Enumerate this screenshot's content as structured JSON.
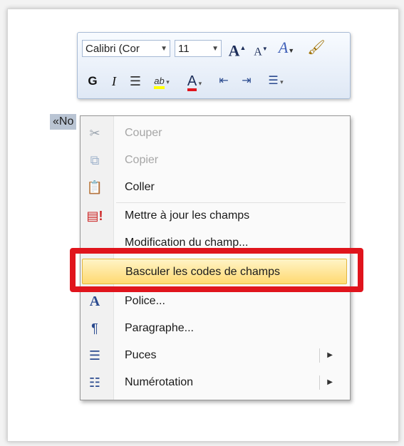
{
  "minibar": {
    "font_name": "Calibri (Cor",
    "font_size": "11",
    "grow_font": "A",
    "shrink_font": "A",
    "styles": "A",
    "bold": "G",
    "italic": "I",
    "font_color": "A"
  },
  "document": {
    "field_text": "«No",
    "field_end": "»"
  },
  "menu": {
    "items": [
      {
        "label": "Couper",
        "icon": "scissors-icon",
        "enabled": false
      },
      {
        "label": "Copier",
        "icon": "copy-icon",
        "enabled": false
      },
      {
        "label": "Coller",
        "icon": "paste-icon",
        "enabled": true
      },
      {
        "label": "Mettre à jour les champs",
        "icon": "update-fields-icon",
        "enabled": true
      },
      {
        "label": "Modification du champ...",
        "icon": "",
        "enabled": true
      },
      {
        "label": "Basculer les codes de champs",
        "icon": "",
        "enabled": true,
        "highlighted": true
      },
      {
        "label": "Police...",
        "icon": "font-icon",
        "enabled": true
      },
      {
        "label": "Paragraphe...",
        "icon": "paragraph-icon",
        "enabled": true
      },
      {
        "label": "Puces",
        "icon": "bullets-icon",
        "enabled": true,
        "submenu": true
      },
      {
        "label": "Numérotation",
        "icon": "numbering-icon",
        "enabled": true,
        "submenu": true
      }
    ]
  },
  "colors": {
    "highlight_box": "#e0141c",
    "hover_item": "#ffd971",
    "font_color_bar": "#e0141c",
    "highlight_bar": "#ffff00"
  }
}
